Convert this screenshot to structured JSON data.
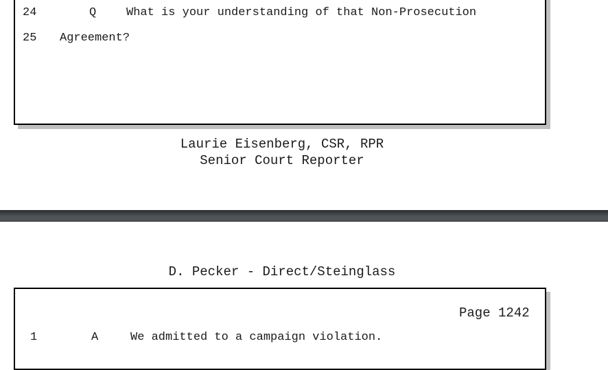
{
  "top_page": {
    "lines": [
      {
        "number": "24",
        "speaker": "Q",
        "text": "What is your understanding of that Non-Prosecution"
      },
      {
        "number": "25",
        "speaker": "",
        "text": "Agreement?"
      }
    ],
    "footer": {
      "reporter": "Laurie Eisenberg, CSR, RPR",
      "title": "Senior Court Reporter"
    }
  },
  "bottom_page": {
    "header": "D. Pecker - Direct/Steinglass",
    "page_label": "Page 1242",
    "lines": [
      {
        "number": "1",
        "speaker": "A",
        "text": "We admitted to a campaign violation."
      }
    ]
  }
}
